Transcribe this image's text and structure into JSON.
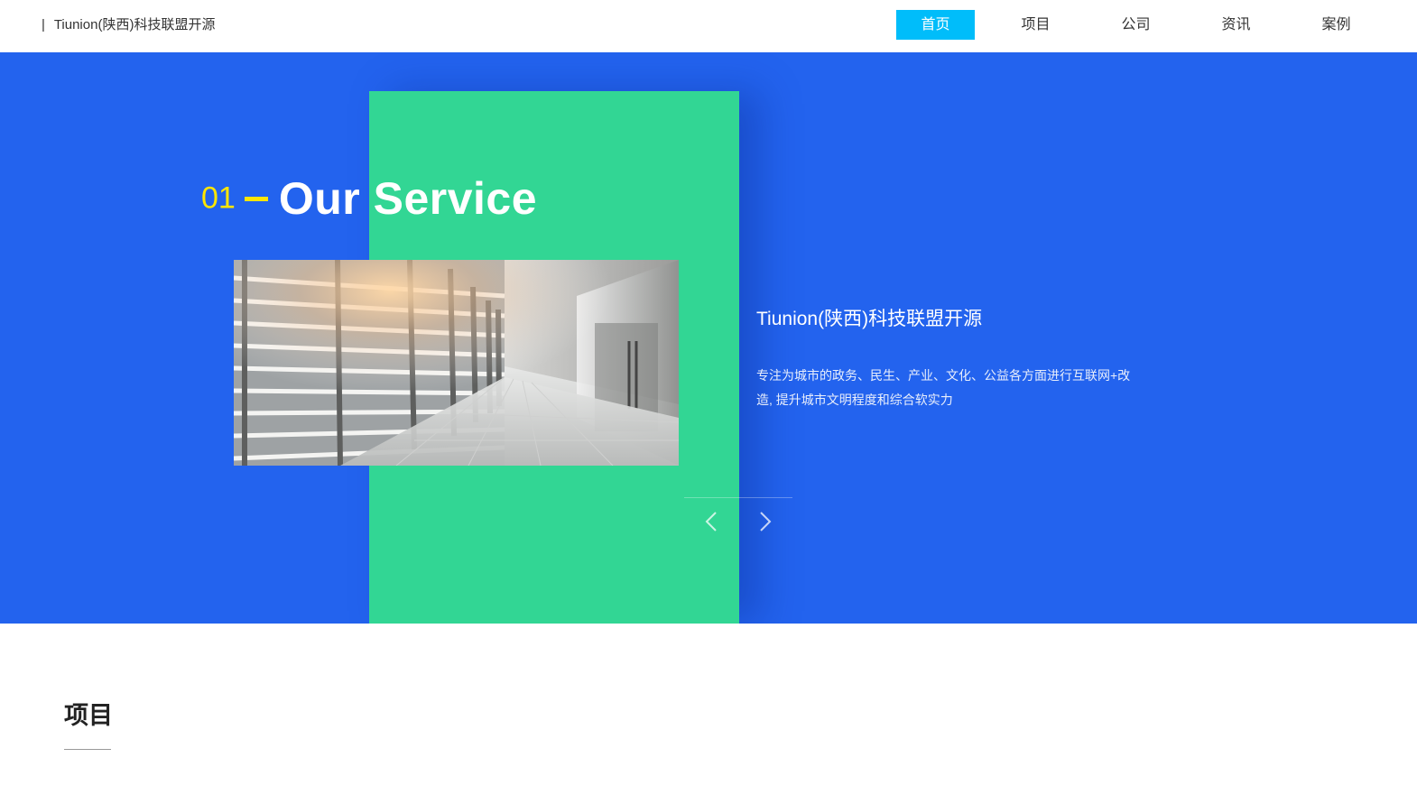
{
  "header": {
    "separator": "|",
    "brand": "Tiunion(陕西)科技联盟开源",
    "nav": [
      {
        "label": "首页",
        "active": true
      },
      {
        "label": "项目",
        "active": false
      },
      {
        "label": "公司",
        "active": false
      },
      {
        "label": "资讯",
        "active": false
      },
      {
        "label": "案例",
        "active": false
      }
    ]
  },
  "hero": {
    "number": "01",
    "title": "Our Service",
    "image_alt": "corridor-photo",
    "text_title": "Tiunion(陕西)科技联盟开源",
    "text_desc": "专注为城市的政务、民生、产业、文化、公益各方面进行互联网+改造, 提升城市文明程度和综合软实力",
    "controls": {
      "prev_icon": "chevron-left-icon",
      "next_icon": "chevron-right-icon"
    }
  },
  "section": {
    "title": "项目"
  },
  "colors": {
    "hero_bg": "#2363ee",
    "panel": "#32d694",
    "accent_yellow": "#ffe600",
    "nav_active": "#00bdfa"
  }
}
